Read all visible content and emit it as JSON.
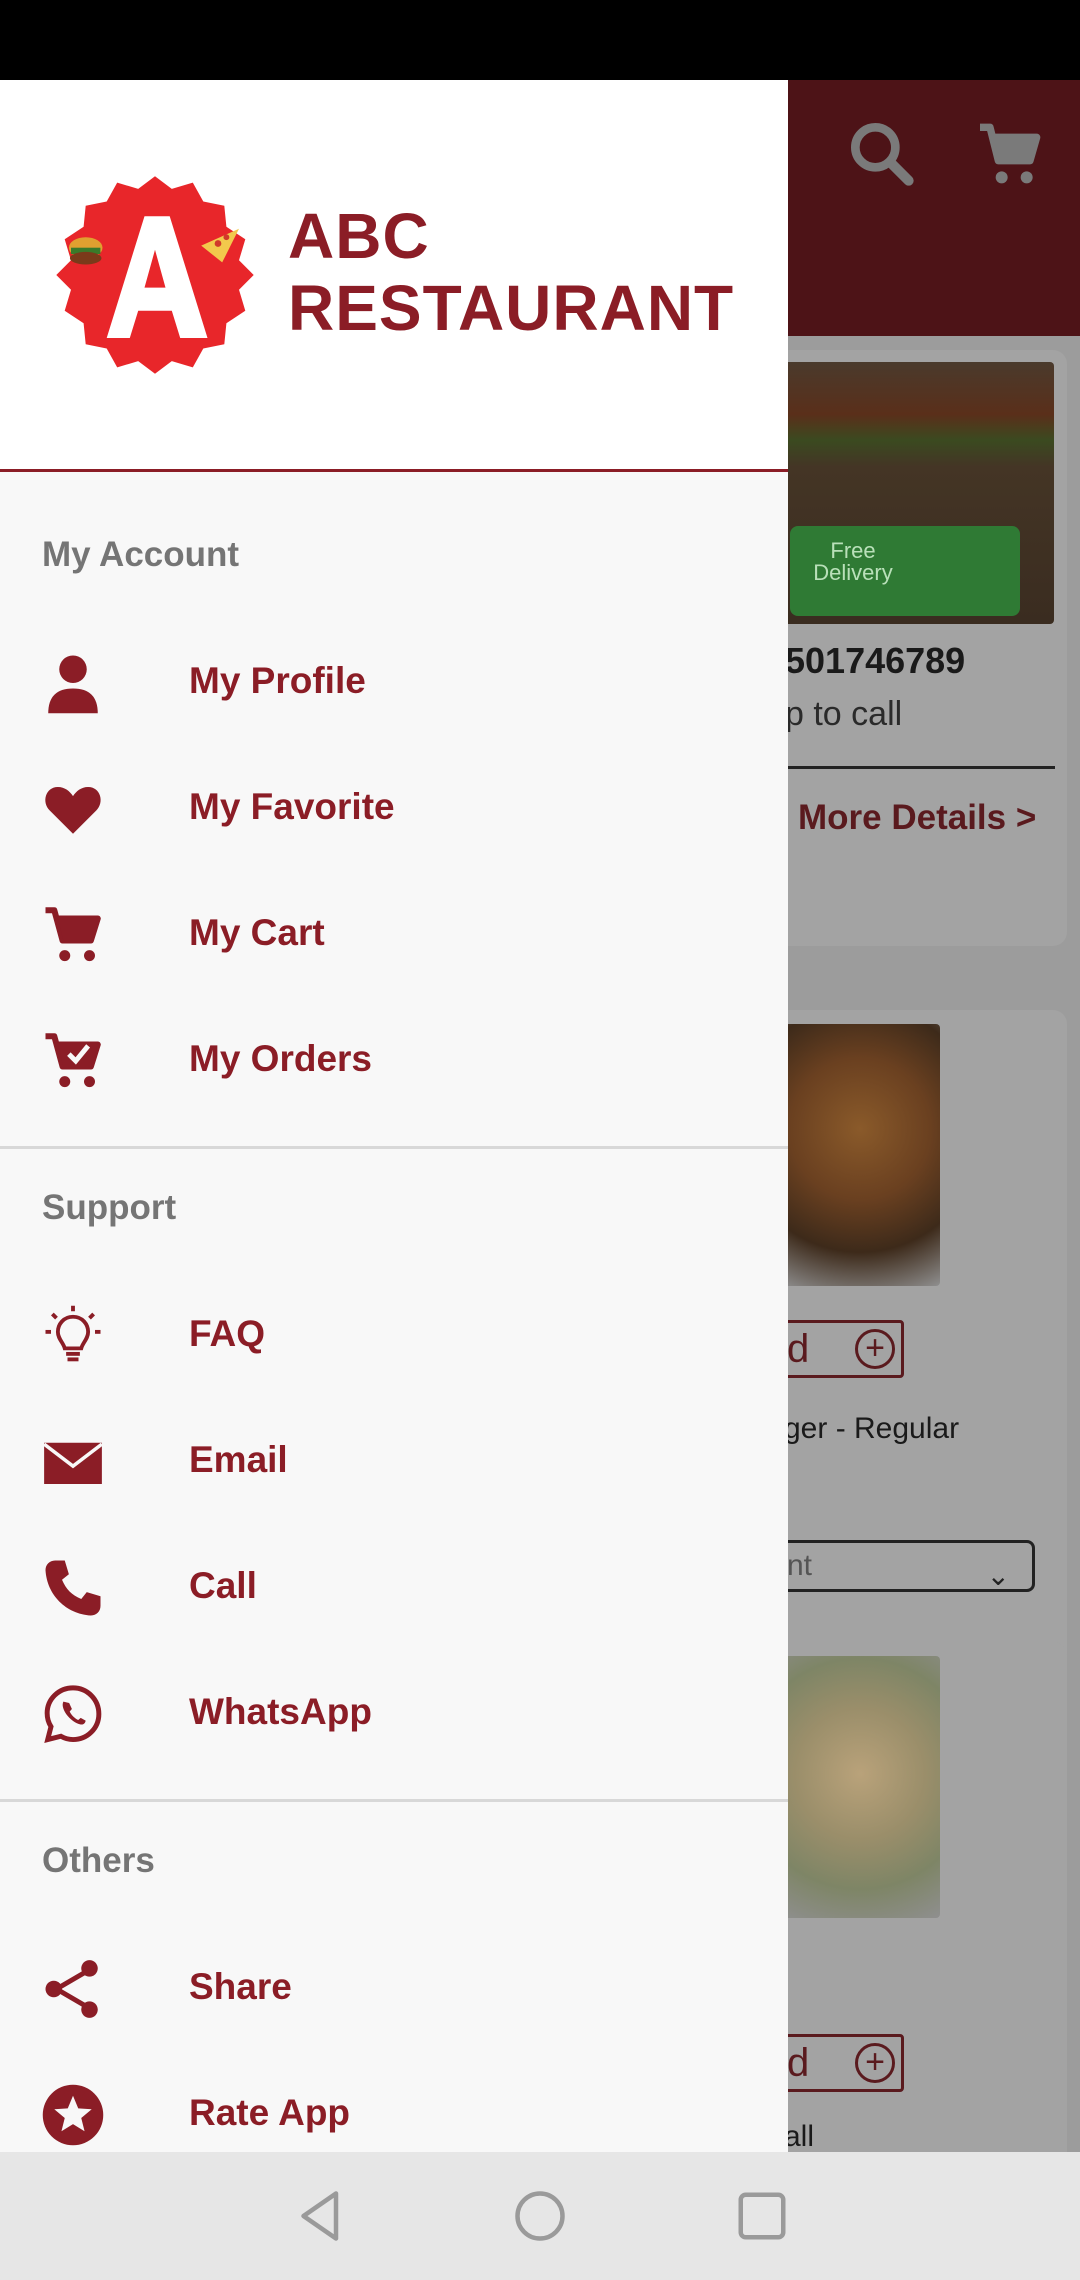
{
  "drawer": {
    "brand_line1": "ABC",
    "brand_line2": "RESTAURANT",
    "sections": [
      {
        "title": "My Account",
        "items": [
          {
            "label": "My Profile",
            "icon": "person-icon"
          },
          {
            "label": "My Favorite",
            "icon": "heart-icon"
          },
          {
            "label": "My Cart",
            "icon": "cart-icon"
          },
          {
            "label": "My Orders",
            "icon": "cart-check-icon"
          }
        ]
      },
      {
        "title": "Support",
        "items": [
          {
            "label": "FAQ",
            "icon": "lightbulb-icon"
          },
          {
            "label": "Email",
            "icon": "envelope-icon"
          },
          {
            "label": "Call",
            "icon": "phone-icon"
          },
          {
            "label": "WhatsApp",
            "icon": "whatsapp-icon"
          }
        ]
      },
      {
        "title": "Others",
        "items": [
          {
            "label": "Share",
            "icon": "share-icon"
          },
          {
            "label": "Rate App",
            "icon": "star-icon"
          }
        ]
      }
    ]
  },
  "background": {
    "phone": "501746789",
    "tap_to_call": "p to call",
    "more_details": "More Details >",
    "banner_text": "Free Delivery",
    "add_label": "d",
    "item1_name": "ger - Regular",
    "select_value": "nt",
    "item2_name": "all"
  },
  "colors": {
    "accent": "#8b1d26",
    "appbar_dim": "#4d1317",
    "section_title": "#757575",
    "logo_red": "#e8262a"
  },
  "navbar": {
    "icons": [
      "back-icon",
      "home-icon",
      "recents-icon"
    ]
  }
}
